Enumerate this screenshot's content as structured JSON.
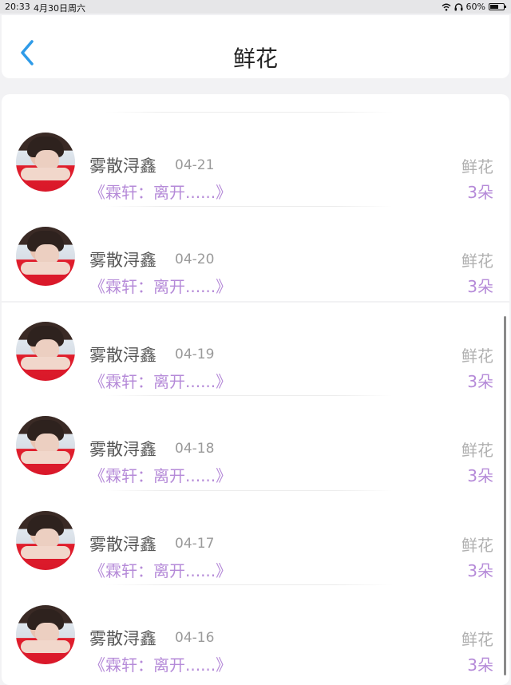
{
  "status_bar": {
    "time": "20:33",
    "date": "4月30日周六",
    "battery": "60%",
    "icons": [
      "wifi-icon",
      "headphones-icon",
      "battery-icon"
    ]
  },
  "header": {
    "title": "鲜花",
    "back_icon": "chevron-left-icon",
    "accent": "#2f9be8"
  },
  "list": {
    "items": [
      {
        "name": "雾散浔鑫",
        "date": "04-21",
        "message": "《霖轩：离开......》",
        "type": "鲜花",
        "count": "3朵"
      },
      {
        "name": "雾散浔鑫",
        "date": "04-20",
        "message": "《霖轩：离开......》",
        "type": "鲜花",
        "count": "3朵"
      },
      {
        "name": "雾散浔鑫",
        "date": "04-19",
        "message": "《霖轩：离开......》",
        "type": "鲜花",
        "count": "3朵"
      },
      {
        "name": "雾散浔鑫",
        "date": "04-18",
        "message": "《霖轩：离开......》",
        "type": "鲜花",
        "count": "3朵"
      },
      {
        "name": "雾散浔鑫",
        "date": "04-17",
        "message": "《霖轩：离开......》",
        "type": "鲜花",
        "count": "3朵"
      },
      {
        "name": "雾散浔鑫",
        "date": "04-16",
        "message": "《霖轩：离开......》",
        "type": "鲜花",
        "count": "3朵"
      }
    ]
  },
  "colors": {
    "message": "#b58ad8",
    "muted": "#b0b0b0"
  }
}
